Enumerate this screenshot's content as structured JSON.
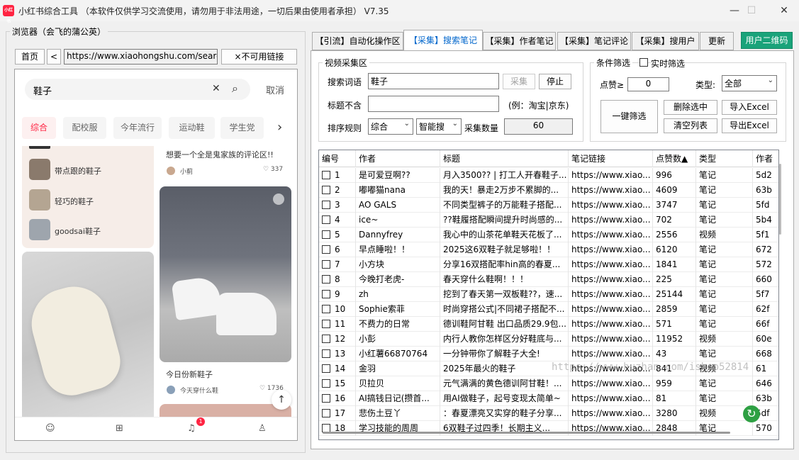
{
  "window": {
    "icon_text": "小红书",
    "title": "小红书综合工具  （本软件仅供学习交流使用，请勿用于非法用途，一切后果由使用者承担）  V7.35",
    "min": "—",
    "max": "☐",
    "close": "✕"
  },
  "browser": {
    "legend": "浏览器（会飞的蒲公英）",
    "home": "首页",
    "back": "<",
    "url": "https://www.xiaohongshu.com/search",
    "unavail": "×不可用链接"
  },
  "xhs": {
    "query": "鞋子",
    "clear": "✕",
    "search_icon": "⌕",
    "cancel": "取消",
    "chips": [
      "综合",
      "配校服",
      "今年流行",
      "运动鞋",
      "学生党"
    ],
    "pills": [
      "带点跟的鞋子",
      "轻巧的鞋子",
      "goodsai鞋子"
    ],
    "card1_title": "想要一个全是鬼家族的评论区!!",
    "card1_user": "小蓟",
    "card1_likes": "♡ 337",
    "card3_title": "今日份新鞋子",
    "card3_user": "今天穿什么鞋",
    "card3_likes": "♡ 1736",
    "badge": "1"
  },
  "tabs": [
    "【引流】自动化操作区",
    "【采集】搜索笔记",
    "【采集】作者笔记",
    "【采集】笔记评论",
    "【采集】搜用户",
    "更新"
  ],
  "qr_btn": "用户二维码",
  "collect": {
    "legend": "视频采集区",
    "kw_label": "搜索词语",
    "kw_value": "鞋子",
    "start": "采集",
    "stop": "停止",
    "exclude_label": "标题不含",
    "exclude_value": "",
    "exclude_hint": "(例：淘宝|京东)",
    "sort_label": "排序规则",
    "sort_value": "综合",
    "mode_value": "智能搜",
    "count_label": "采集数量",
    "count_value": "60"
  },
  "filter": {
    "legend": "条件筛选",
    "realtime": "实时筛选",
    "likes_label": "点赞≥",
    "likes_value": "0",
    "type_label": "类型:",
    "type_value": "全部",
    "one_click": "一键筛选",
    "del_sel": "删除选中",
    "import": "导入Excel",
    "clear": "清空列表",
    "export": "导出Excel"
  },
  "table": {
    "headers": [
      "编号",
      "作者",
      "标题",
      "笔记链接",
      "点赞数▲",
      "类型",
      "作者"
    ],
    "rows": [
      [
        "1",
        "是可爱豆啊??",
        "月入3500?? | 打工人开春鞋子...",
        "https://www.xiao...",
        "996",
        "笔记",
        "5d2"
      ],
      [
        "2",
        "嘟嘟猫nana",
        "我的天！暴走2万步不累脚的...",
        "https://www.xiao...",
        "4609",
        "笔记",
        "63b"
      ],
      [
        "3",
        "AO GALS",
        "不同类型裤子的万能鞋子搭配...",
        "https://www.xiao...",
        "3747",
        "笔记",
        "5fd"
      ],
      [
        "4",
        "ice~",
        "??鞋履搭配瞬间提升时尚感的...",
        "https://www.xiao...",
        "702",
        "笔记",
        "5b4"
      ],
      [
        "5",
        "Dannyfrey",
        "我心中的山茶花单鞋天花板了...",
        "https://www.xiao...",
        "2556",
        "视频",
        "5f1"
      ],
      [
        "6",
        "早点睡啦！！",
        "2025这6双鞋子就足够啦！！",
        "https://www.xiao...",
        "6120",
        "笔记",
        "672"
      ],
      [
        "7",
        "小方块",
        "分享16双搭配率hin高的春夏...",
        "https://www.xiao...",
        "1841",
        "笔记",
        "572"
      ],
      [
        "8",
        "今晚打老虎-",
        "春天穿什么鞋啊！！！",
        "https://www.xiao...",
        "225",
        "笔记",
        "660"
      ],
      [
        "9",
        "zh",
        "挖到了春天第一双板鞋??，速...",
        "https://www.xiao...",
        "25144",
        "笔记",
        "5f7"
      ],
      [
        "10",
        "Sophie索菲",
        "时尚穿搭公式|不同裙子搭配不...",
        "https://www.xiao...",
        "2859",
        "笔记",
        "62f"
      ],
      [
        "11",
        "不费力的日常",
        "德训鞋阿甘鞋 出口品质29.9包...",
        "https://www.xiao...",
        "571",
        "笔记",
        "66f"
      ],
      [
        "12",
        "小彭",
        "内行人教你怎样区分好鞋底与...",
        "https://www.xiao...",
        "11952",
        "视频",
        "60e"
      ],
      [
        "13",
        "小红薯66870764",
        "一分钟带你了解鞋子大全!",
        "https://www.xiao...",
        "43",
        "笔记",
        "668"
      ],
      [
        "14",
        "金羽",
        "2025年最火的鞋子",
        "https://www.xiao...",
        "841",
        "视频",
        "61"
      ],
      [
        "15",
        "贝拉贝",
        "元气满满的黄色德训阿甘鞋！...",
        "https://www.xiao...",
        "959",
        "笔记",
        "646"
      ],
      [
        "16",
        "AI搞钱日记(攒首...",
        "用AI做鞋子，起号变现太简单~",
        "https://www.xiao...",
        "81",
        "笔记",
        "63b"
      ],
      [
        "17",
        "悲伤土豆丫",
        "：春夏漂亮又实穿的鞋子分享...",
        "https://www.xiao...",
        "3280",
        "视频",
        "5df"
      ],
      [
        "18",
        "学习技能的周周",
        "6双鞋子过四季！长期主义...",
        "https://www.xiao...",
        "2848",
        "笔记",
        "570"
      ]
    ]
  },
  "watermark": "https://www.huzhan.com/ishop52814",
  "refresh_icon": "↻"
}
